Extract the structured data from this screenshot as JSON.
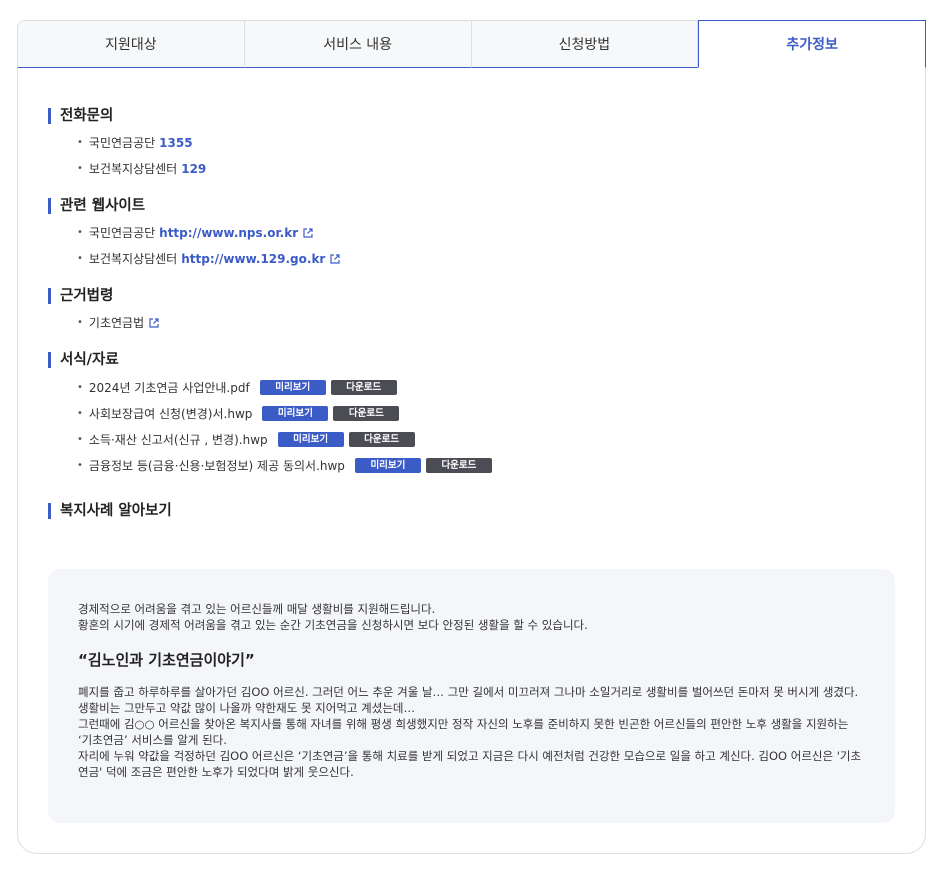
{
  "tabs": [
    "지원대상",
    "서비스 내용",
    "신청방법",
    "추가정보"
  ],
  "active_tab_index": 3,
  "phone": {
    "title": "전화문의",
    "items": [
      {
        "label": "국민연금공단",
        "value": "1355"
      },
      {
        "label": "보건복지상담센터",
        "value": "129"
      }
    ]
  },
  "websites": {
    "title": "관련 웹사이트",
    "items": [
      {
        "label": "국민연금공단",
        "url": "http://www.nps.or.kr"
      },
      {
        "label": "보건복지상담센터",
        "url": "http://www.129.go.kr"
      }
    ]
  },
  "laws": {
    "title": "근거법령",
    "items": [
      {
        "label": "기초연금법"
      }
    ]
  },
  "forms": {
    "title": "서식/자료",
    "preview_label": "미리보기",
    "download_label": "다운로드",
    "items": [
      {
        "name": "2024년 기초연금 사업안내.pdf"
      },
      {
        "name": "사회보장급여 신청(변경)서.hwp"
      },
      {
        "name": "소득·재산 신고서(신규 , 변경).hwp"
      },
      {
        "name": "금융정보 등(금융·신용·보험정보) 제공 동의서.hwp"
      }
    ]
  },
  "cases": {
    "title": "복지사례 알아보기",
    "intro_line1": "경제적으로 어려움을 겪고 있는 어르신들께 매달 생활비를 지원해드립니다.",
    "intro_line2": "황혼의 시기에 경제적 어려움을 겪고 있는 순간 기초연금을 신청하시면 보다 안정된 생활을 할 수 있습니다.",
    "story_title": "“김노인과 기초연금이야기”",
    "story_p1": "폐지를 줍고 하루하루를 살아가던 김OO 어르신. 그러던 어느 추운 겨울 날… 그만 길에서 미끄러져 그나마 소일거리로 생활비를 벌어쓰던 돈마저 못 버시게 생겼다. 생활비는 그만두고 약값 많이 나올까 약한재도 못 지어먹고 계셨는데…",
    "story_p2": "그런때에 김○○ 어르신을 찾아온 복지사를 통해 자녀를 위해 평생 희생했지만 정작 자신의 노후를 준비하지 못한 빈곤한 어르신들의 편안한 노후 생활을 지원하는 ‘기초연금’ 서비스를 알게 된다.",
    "story_p3": "자리에 누워 약값을 걱정하던 김OO 어르신은 ‘기초연금’을 통해 치료를 받게 되었고 지금은 다시 예전처럼 건강한 모습으로 일을 하고 계신다. 김OO 어르신은 '기초연금' 덕에 조금은 편안한 노후가 되었다며 밝게 웃으신다."
  }
}
